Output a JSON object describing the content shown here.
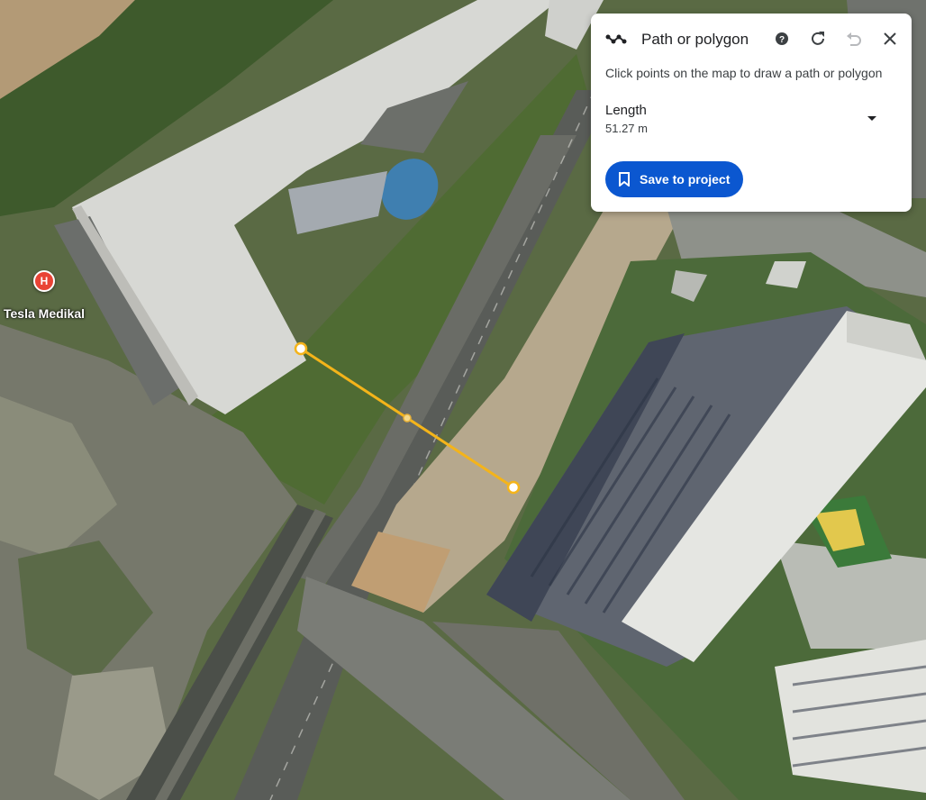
{
  "map": {
    "poi": {
      "name": "Tesla Medikal",
      "icon": "hospital-pin-icon",
      "glyph": "H"
    },
    "measurement_points": 3
  },
  "panel": {
    "title": "Path or polygon",
    "icons": [
      "path-icon",
      "help-icon",
      "redo-icon",
      "undo-icon",
      "close-icon"
    ],
    "instructions": "Click points on the map to draw a path or polygon",
    "measurement": {
      "label": "Length",
      "value": "51.27 m",
      "dropdown_icon": "caret-down-icon"
    },
    "save_button": {
      "label": "Save to project",
      "icon": "bookmark-icon"
    },
    "accent_color": "#0b57d0"
  },
  "colors": {
    "measure_line": "#f4b41a",
    "poi_red": "#e94335"
  }
}
